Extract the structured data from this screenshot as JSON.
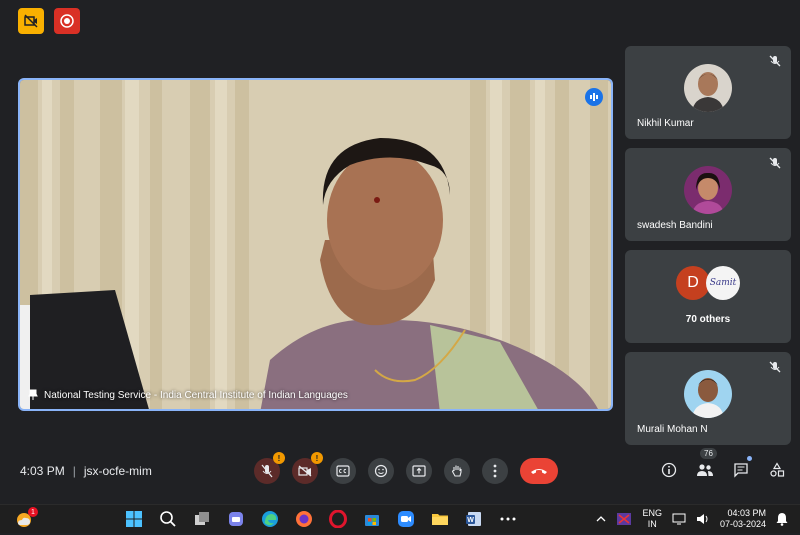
{
  "main": {
    "caption": "National Testing Service - India Central Institute of Indian Languages"
  },
  "participants": [
    {
      "name": "Nikhil Kumar"
    },
    {
      "name": "swadesh Bandini"
    },
    {
      "name": "70 others",
      "avatar_initial": "D",
      "avatar2_text": "Samit"
    },
    {
      "name": "Murali Mohan N"
    }
  ],
  "bottom_bar": {
    "time": "4:03 PM",
    "separator": "|",
    "meeting_code": "jsx-ocfe-mim",
    "people_count": "76",
    "mic_badge": "!",
    "cam_badge": "!"
  },
  "taskbar": {
    "notif_count": "1",
    "lang_line1": "ENG",
    "lang_line2": "IN",
    "clock_time": "04:03 PM",
    "clock_date": "07-03-2024"
  },
  "colors": {
    "background": "#202124",
    "tile": "#3c4043",
    "accent_blue": "#8ab4f8",
    "end_call": "#ea4335",
    "warn": "#f29900"
  }
}
